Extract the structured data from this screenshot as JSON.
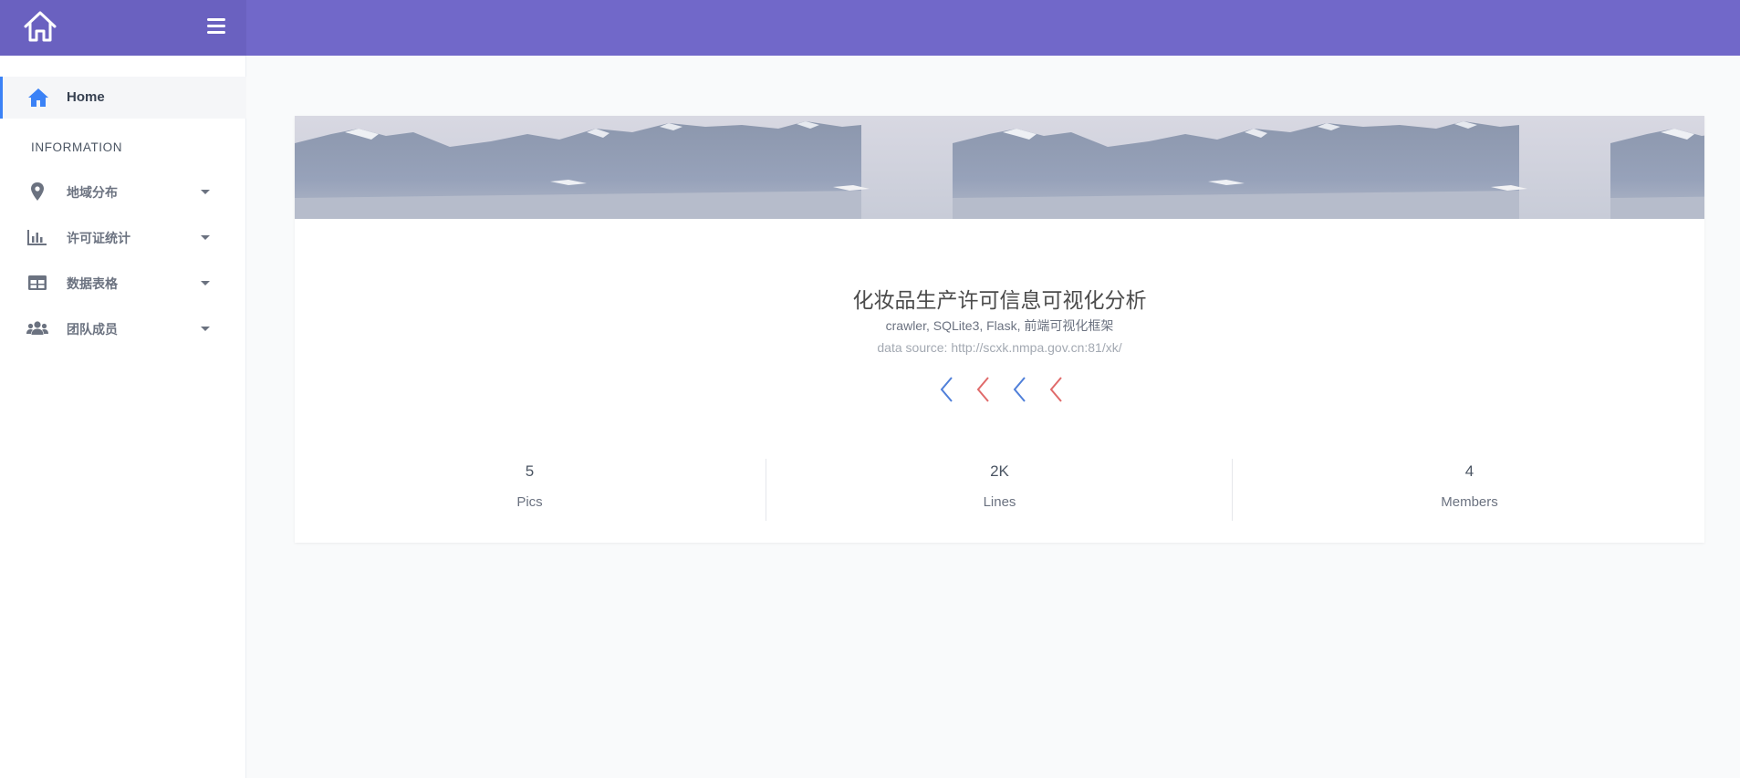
{
  "topbar": {
    "logo_icon": "home-outline-icon",
    "menu_icon": "hamburger-icon",
    "bar_color": "#7168c9",
    "brand_color": "#6a61c0"
  },
  "sidebar": {
    "home": {
      "label": "Home",
      "icon": "home-icon",
      "accent": "#3b82f6"
    },
    "section_title": "INFORMATION",
    "items": [
      {
        "label": "地域分布",
        "icon": "map-marker-icon"
      },
      {
        "label": "许可证统计",
        "icon": "bar-chart-icon"
      },
      {
        "label": "数据表格",
        "icon": "table-icon"
      },
      {
        "label": "团队成员",
        "icon": "users-icon"
      }
    ]
  },
  "card": {
    "title": "化妆品生产许可信息可视化分析",
    "subtitle": "crawler, SQLite3, Flask, 前端可视化框架",
    "source": "data source: http://scxk.nmpa.gov.cn:81/xk/",
    "icons": [
      "chevron-left-blue-icon",
      "chevron-left-red-icon",
      "chevron-left-blue-icon",
      "chevron-left-red-icon"
    ],
    "stats": [
      {
        "value": "5",
        "label": "Pics"
      },
      {
        "value": "2K",
        "label": "Lines"
      },
      {
        "value": "4",
        "label": "Members"
      }
    ]
  }
}
